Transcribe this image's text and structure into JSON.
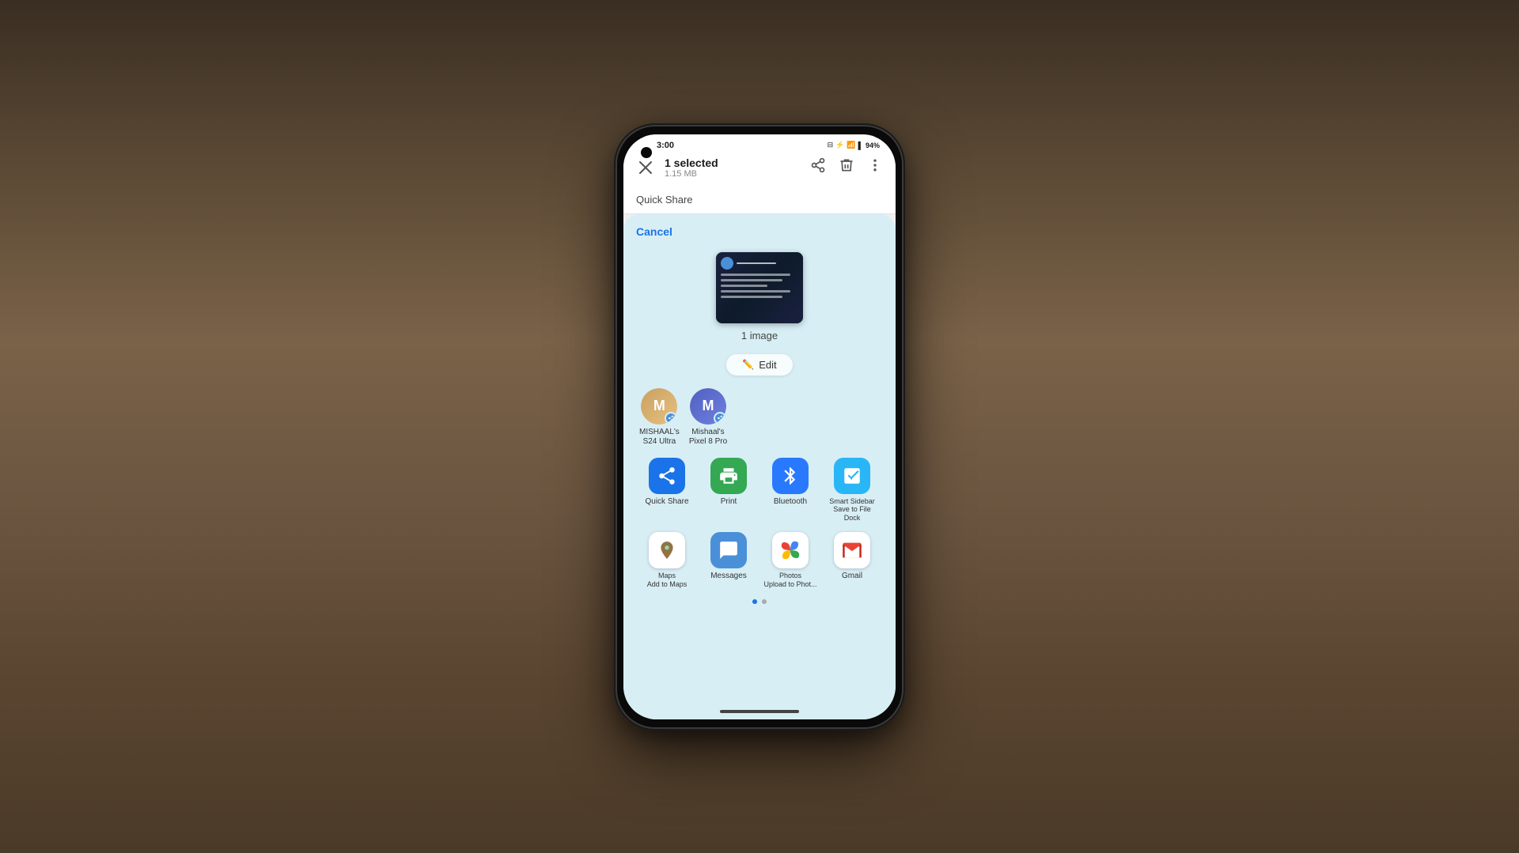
{
  "background": {
    "wall_color": "#2d2d2d",
    "table_color": "#5a4a3a"
  },
  "phone": {
    "status_bar": {
      "time": "3:00",
      "battery_percent": "94%",
      "icons": [
        "notification",
        "bluetooth",
        "wifi",
        "signal"
      ]
    },
    "top_bar": {
      "close_label": "×",
      "title": "1 selected",
      "subtitle": "1.15 MB",
      "share_icon": "share",
      "delete_icon": "delete",
      "more_icon": "more"
    },
    "quick_share_section": {
      "label": "Quick Share"
    },
    "share_sheet": {
      "cancel_label": "Cancel",
      "image_count": "1 image",
      "edit_label": "Edit",
      "contacts": [
        {
          "name": "MISHAAL's\nS24 Ultra",
          "avatar_color": "#e8b86d",
          "initials": "M",
          "badge": "share"
        },
        {
          "name": "Mishaal's\nPixel 8 Pro",
          "avatar_color": "#6d8de8",
          "initials": "M",
          "badge": "share"
        }
      ],
      "apps_row1": [
        {
          "id": "quick-share",
          "label": "Quick Share",
          "icon_color": "#1a73e8",
          "icon_type": "quick-share"
        },
        {
          "id": "print",
          "label": "Print",
          "icon_color": "#34a853",
          "icon_type": "print"
        },
        {
          "id": "bluetooth",
          "label": "Bluetooth",
          "icon_color": "#2979ff",
          "icon_type": "bluetooth"
        },
        {
          "id": "smart-sidebar",
          "label": "Smart Sidebar\nSave to File Dock",
          "icon_color": "#29b6f6",
          "icon_type": "smart-sidebar"
        }
      ],
      "apps_row2": [
        {
          "id": "maps",
          "label": "Maps\nAdd to Maps",
          "icon_color": "#ffffff",
          "icon_type": "maps"
        },
        {
          "id": "messages",
          "label": "Messages",
          "icon_color": "#4a90d9",
          "icon_type": "messages"
        },
        {
          "id": "photos",
          "label": "Photos\nUpload to Phot...",
          "icon_color": "#ffffff",
          "icon_type": "photos"
        },
        {
          "id": "gmail",
          "label": "Gmail",
          "icon_color": "#ffffff",
          "icon_type": "gmail"
        }
      ],
      "page_dots": [
        {
          "active": true
        },
        {
          "active": false
        }
      ]
    }
  }
}
